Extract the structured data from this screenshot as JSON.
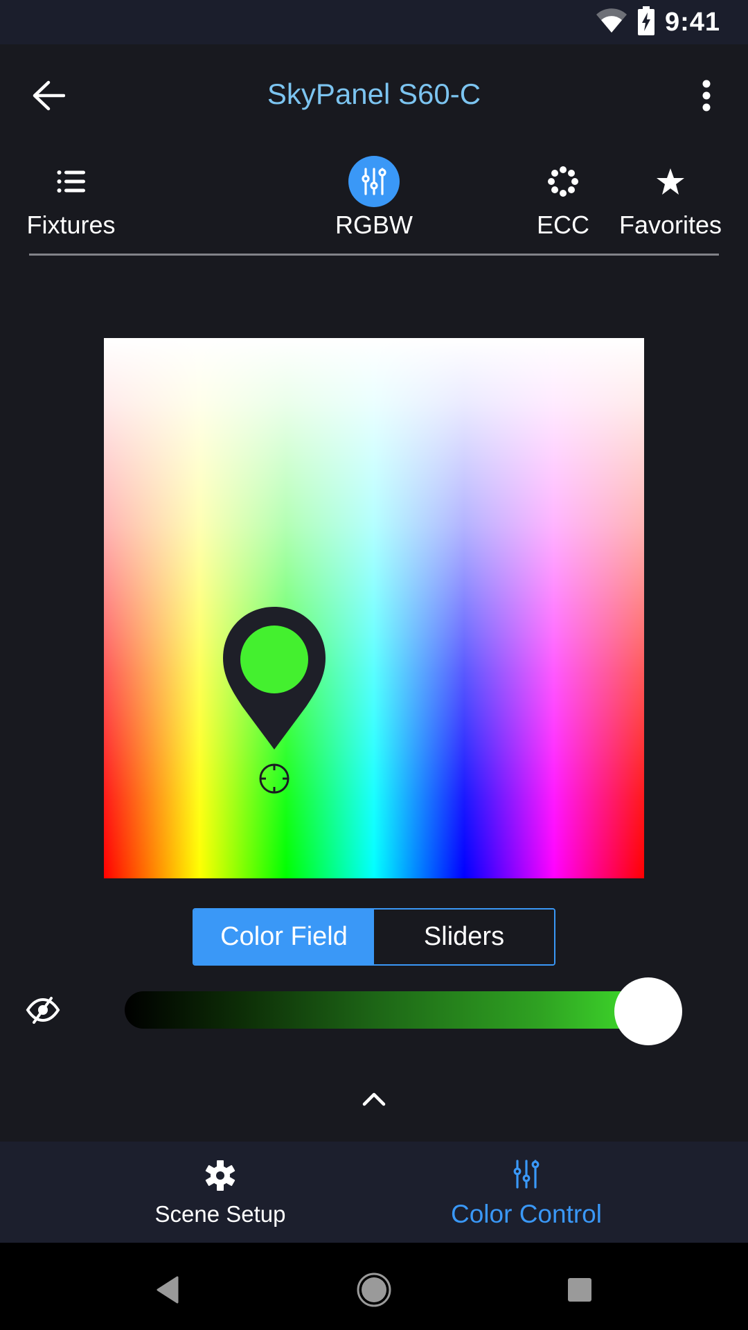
{
  "status_bar": {
    "time": "9:41",
    "icons": [
      "wifi-icon",
      "battery-charging-icon"
    ]
  },
  "app_bar": {
    "title": "SkyPanel S60-C",
    "back_icon": "arrow-left-icon",
    "menu_icon": "more-vertical-icon"
  },
  "tabs": [
    {
      "label": "Fixtures",
      "icon": "list-icon",
      "active": false
    },
    {
      "label": "RGBW",
      "icon": "sliders-icon",
      "active": true
    },
    {
      "label": "ECC",
      "icon": "dots-ring-icon",
      "active": false
    },
    {
      "label": "Favorites",
      "icon": "star-icon",
      "active": false
    }
  ],
  "color_field": {
    "selected_color": "#44f02f",
    "selection_position": {
      "hue_fraction": 0.315,
      "saturation_fraction": 0.816
    },
    "marker_icon": "map-pin-icon",
    "target_icon": "crosshair-icon"
  },
  "mode_toggle": {
    "options": [
      "Color Field",
      "Sliders"
    ],
    "selected": "Color Field"
  },
  "intensity": {
    "visibility_icon": "eye-off-icon",
    "value_fraction": 1.0,
    "track_color_end": "#44f02f"
  },
  "expand": {
    "icon": "chevron-up-icon"
  },
  "bottom_nav": {
    "items": [
      {
        "label": "Scene Setup",
        "icon": "gear-icon",
        "active": false
      },
      {
        "label": "Color Control",
        "icon": "sliders-icon",
        "active": true
      }
    ]
  },
  "system_nav": {
    "buttons": [
      "back-triangle-icon",
      "home-circle-icon",
      "recents-square-icon"
    ]
  },
  "colors": {
    "accent": "#3a98f7",
    "title": "#7cc4f0",
    "background": "#18191f",
    "nav_background": "#1c1f2d"
  }
}
